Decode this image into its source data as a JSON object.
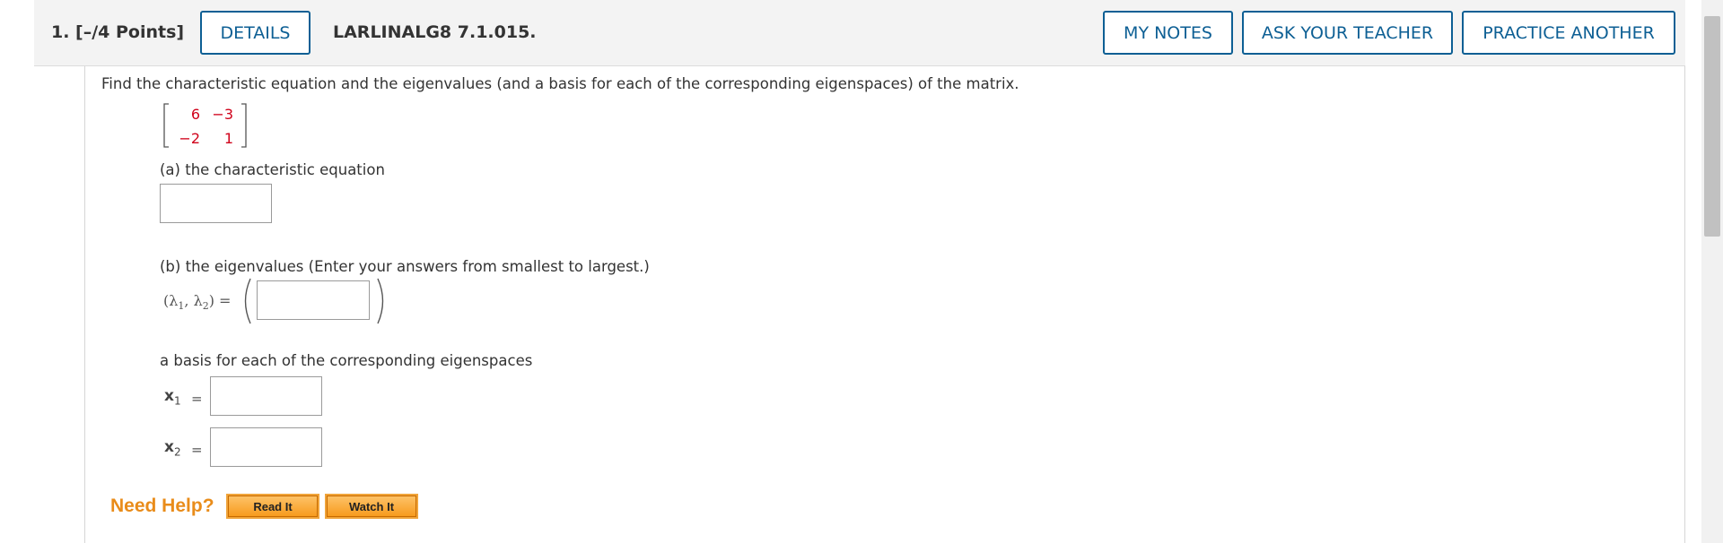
{
  "question": {
    "number_label": "1.  [–/4 Points]",
    "details_label": "DETAILS",
    "code": "LARLINALG8 7.1.015.",
    "my_notes_label": "MY NOTES",
    "ask_teacher_label": "ASK YOUR TEACHER",
    "practice_another_label": "PRACTICE ANOTHER"
  },
  "problem": {
    "prompt": "Find the characteristic equation and the eigenvalues (and a basis for each of the corresponding eigenspaces) of the matrix.",
    "matrix": {
      "r1c1": "6",
      "r1c2": "−3",
      "r2c1": "−2",
      "r2c2": "1"
    },
    "part_a": "(a) the characteristic equation",
    "part_b": "(b) the eigenvalues (Enter your answers from smallest to largest.)",
    "eigen_lhs": "(λ",
    "eigen_sub1": "1",
    "eigen_mid": ", λ",
    "eigen_sub2": "2",
    "eigen_rhs": ") =",
    "basis_label": "a basis for each of the corresponding eigenspaces",
    "x_label": "x",
    "x1_sub": "1",
    "x2_sub": "2",
    "equals": "="
  },
  "help": {
    "need_help": "Need Help?",
    "read_it": "Read It",
    "watch_it": "Watch It"
  },
  "colors": {
    "accent": "#0d5f94",
    "matrix_entries": "#d0021b",
    "need_help": "#e98c1a",
    "help_button": "#f79b1e"
  }
}
